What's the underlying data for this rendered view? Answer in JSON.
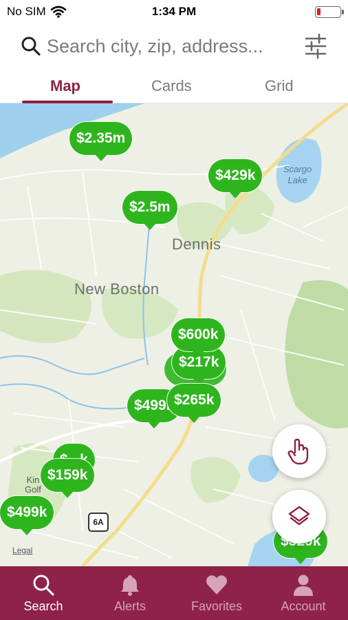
{
  "status_bar": {
    "carrier": "No SIM",
    "time": "1:34 PM"
  },
  "search": {
    "placeholder": "Search city, zip, address..."
  },
  "tabs": [
    {
      "label": "Map",
      "active": true
    },
    {
      "label": "Cards",
      "active": false
    },
    {
      "label": "Grid",
      "active": false
    }
  ],
  "map": {
    "places": {
      "dennis": "Dennis",
      "new_boston": "New Boston"
    },
    "lake_label": {
      "line1": "Scargo",
      "line2": "Lake"
    },
    "route_shield": "6A",
    "legal": "Legal",
    "golf_label": "Kin Golf",
    "pins": [
      "$2.35m",
      "$429k",
      "$2.5m",
      "$600k",
      "$217k",
      "$499k",
      "$265k",
      "$159k",
      "$499k",
      "$329k"
    ],
    "pin_color": "#2eb51e"
  },
  "nav": {
    "items": [
      {
        "label": "Search",
        "icon": "search-icon",
        "active": true
      },
      {
        "label": "Alerts",
        "icon": "bell-icon",
        "active": false
      },
      {
        "label": "Favorites",
        "icon": "heart-icon",
        "active": false
      },
      {
        "label": "Account",
        "icon": "person-icon",
        "active": false
      }
    ],
    "color": "#8e2248"
  }
}
